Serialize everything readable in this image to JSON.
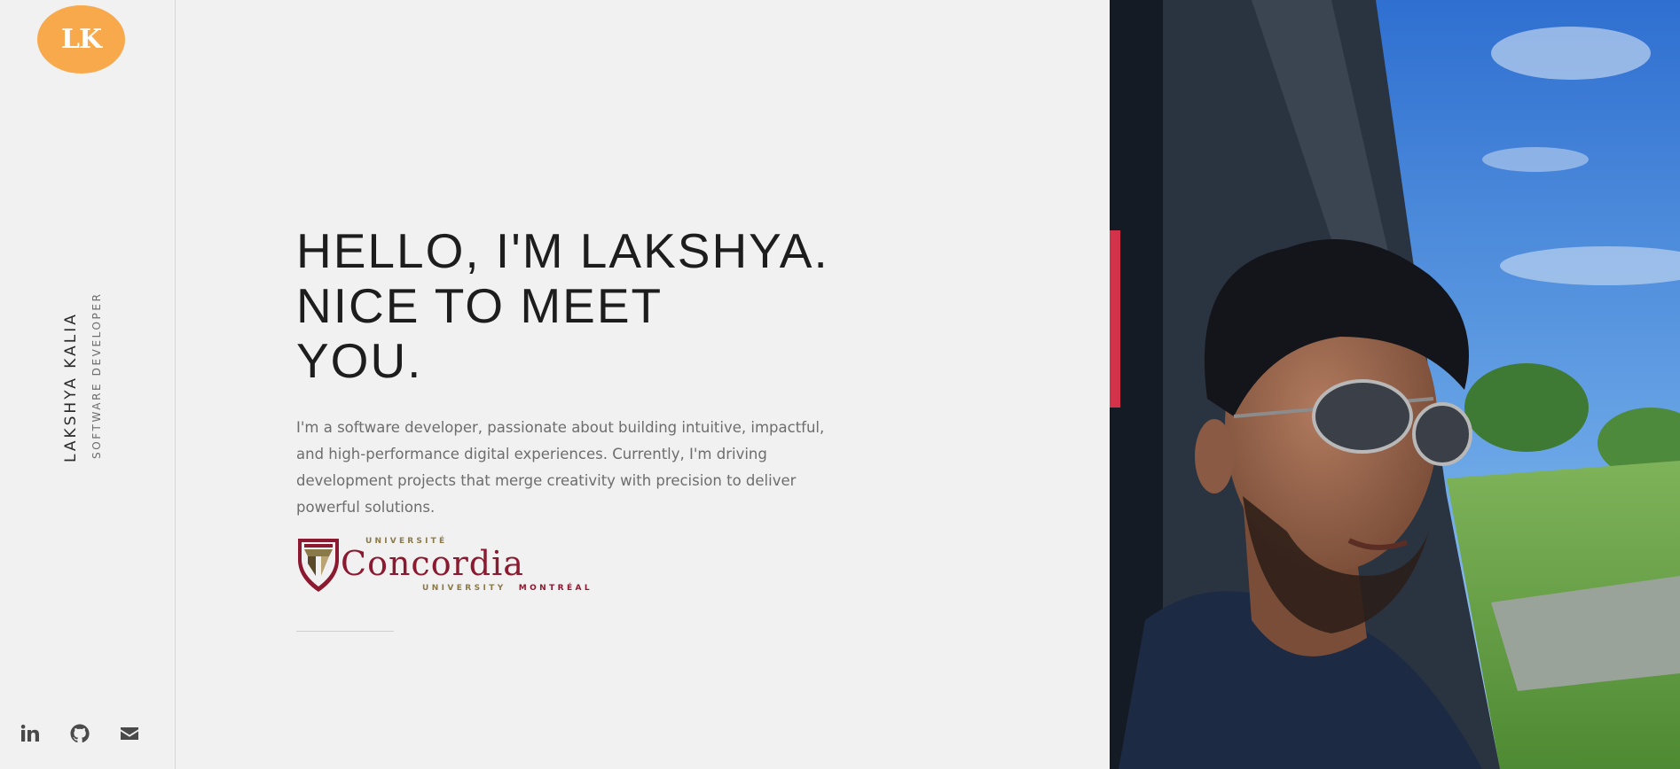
{
  "sidebar": {
    "logo_text": "LK",
    "name": "LAKSHYA KALIA",
    "role": "SOFTWARE DEVELOPER",
    "socials": [
      {
        "label": "linkedin",
        "icon": "linkedin-icon"
      },
      {
        "label": "github",
        "icon": "github-icon"
      },
      {
        "label": "email",
        "icon": "mail-icon"
      }
    ]
  },
  "hero": {
    "headline": [
      "HELLO, I'M LAKSHYA.",
      "NICE TO MEET",
      "YOU."
    ],
    "intro": "I'm a software developer, passionate about building intuitive, impactful, and high-performance digital experiences. Currently, I'm driving development projects that merge creativity with precision to deliver powerful solutions."
  },
  "education_logo": {
    "top": "UNIVERSITÉ",
    "name": "Concordia",
    "bottom_left": "UNIVERSITY",
    "bottom_right": "MONTRÉAL"
  },
  "colors": {
    "background": "#f1f1f1",
    "logo_accent": "#f8a94c",
    "concordia_red": "#8b1a30",
    "concordia_gold": "#8a7a4a"
  }
}
